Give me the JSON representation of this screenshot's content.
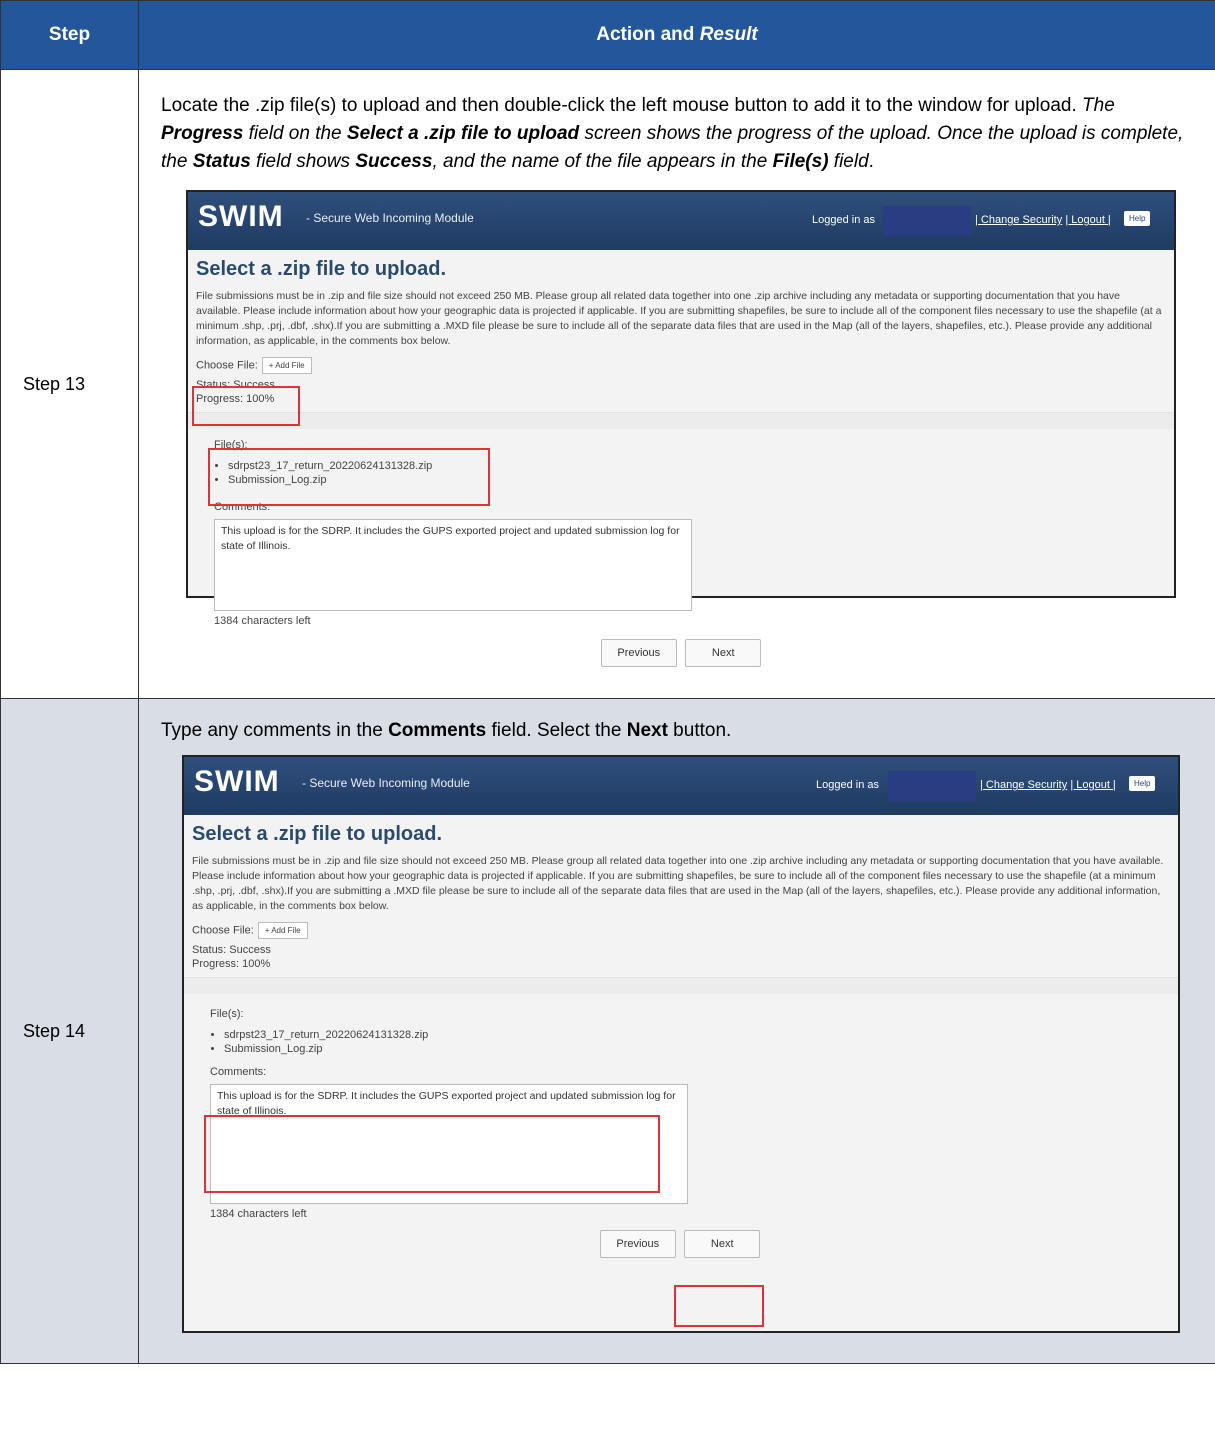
{
  "header": {
    "col1": "Step",
    "col2_normal": "Action and ",
    "col2_italic": "Result"
  },
  "swim": {
    "logo": "SWIM",
    "tagline": "- Secure Web Incoming Module",
    "logged_in": "Logged in as",
    "change_security": "| Change Security",
    "logout": "| Logout |",
    "help": "Help",
    "page_title": "Select a .zip file to upload.",
    "description": "File submissions must be in .zip and file size should not exceed 250 MB. Please group all related data together into one .zip archive including any metadata or supporting documentation that you have available. Please include information about how your geographic data is projected if applicable. If you are submitting shapefiles, be sure to include all of the component files necessary to use the shapefile (at a minimum .shp, .prj, .dbf, .shx).If you are submitting a .MXD file please be sure to include all of the separate data files that are used in the Map (all of the layers, shapefiles, etc.). Please provide any additional information, as applicable, in the comments box below.",
    "choose_file": "Choose File:",
    "add_file": "+ Add File",
    "status": "Status: Success",
    "progress": "Progress: 100%",
    "files_label": "File(s):",
    "files": [
      "sdrpst23_17_return_20220624131328.zip",
      "Submission_Log.zip"
    ],
    "comments_label": "Comments:",
    "comment_text": "This upload is for the SDRP. It includes the GUPS exported project and updated submission log for state of Illinois.",
    "chars_left": "1384 characters left",
    "previous": "Previous",
    "next": "Next"
  },
  "steps": [
    {
      "label": "Step 13",
      "text": {
        "a": "Locate the .zip file(s) to upload and then double-click the left mouse button to add it to the window for upload. ",
        "b": "The ",
        "c": "Progress",
        "d": " field on the ",
        "e": "Select a .zip file to upload",
        "f": " screen shows the progress of the upload. Once the upload is complete, the ",
        "g": "Status",
        "h": " field shows ",
        "i": "Success",
        "j": ", and the name of the file appears in the ",
        "k": "File(s)",
        "l": " field",
        "m": "."
      }
    },
    {
      "label": "Step 14",
      "text": {
        "a": "Type any comments in the ",
        "b": "Comments",
        "c": " field. Select the ",
        "d": "Next",
        "e": " button."
      }
    }
  ],
  "colors": {
    "header_bg": "#24569b",
    "row2_bg": "#d8dde6",
    "highlight": "#e0323a",
    "swim_bar": "#1f3b62"
  }
}
